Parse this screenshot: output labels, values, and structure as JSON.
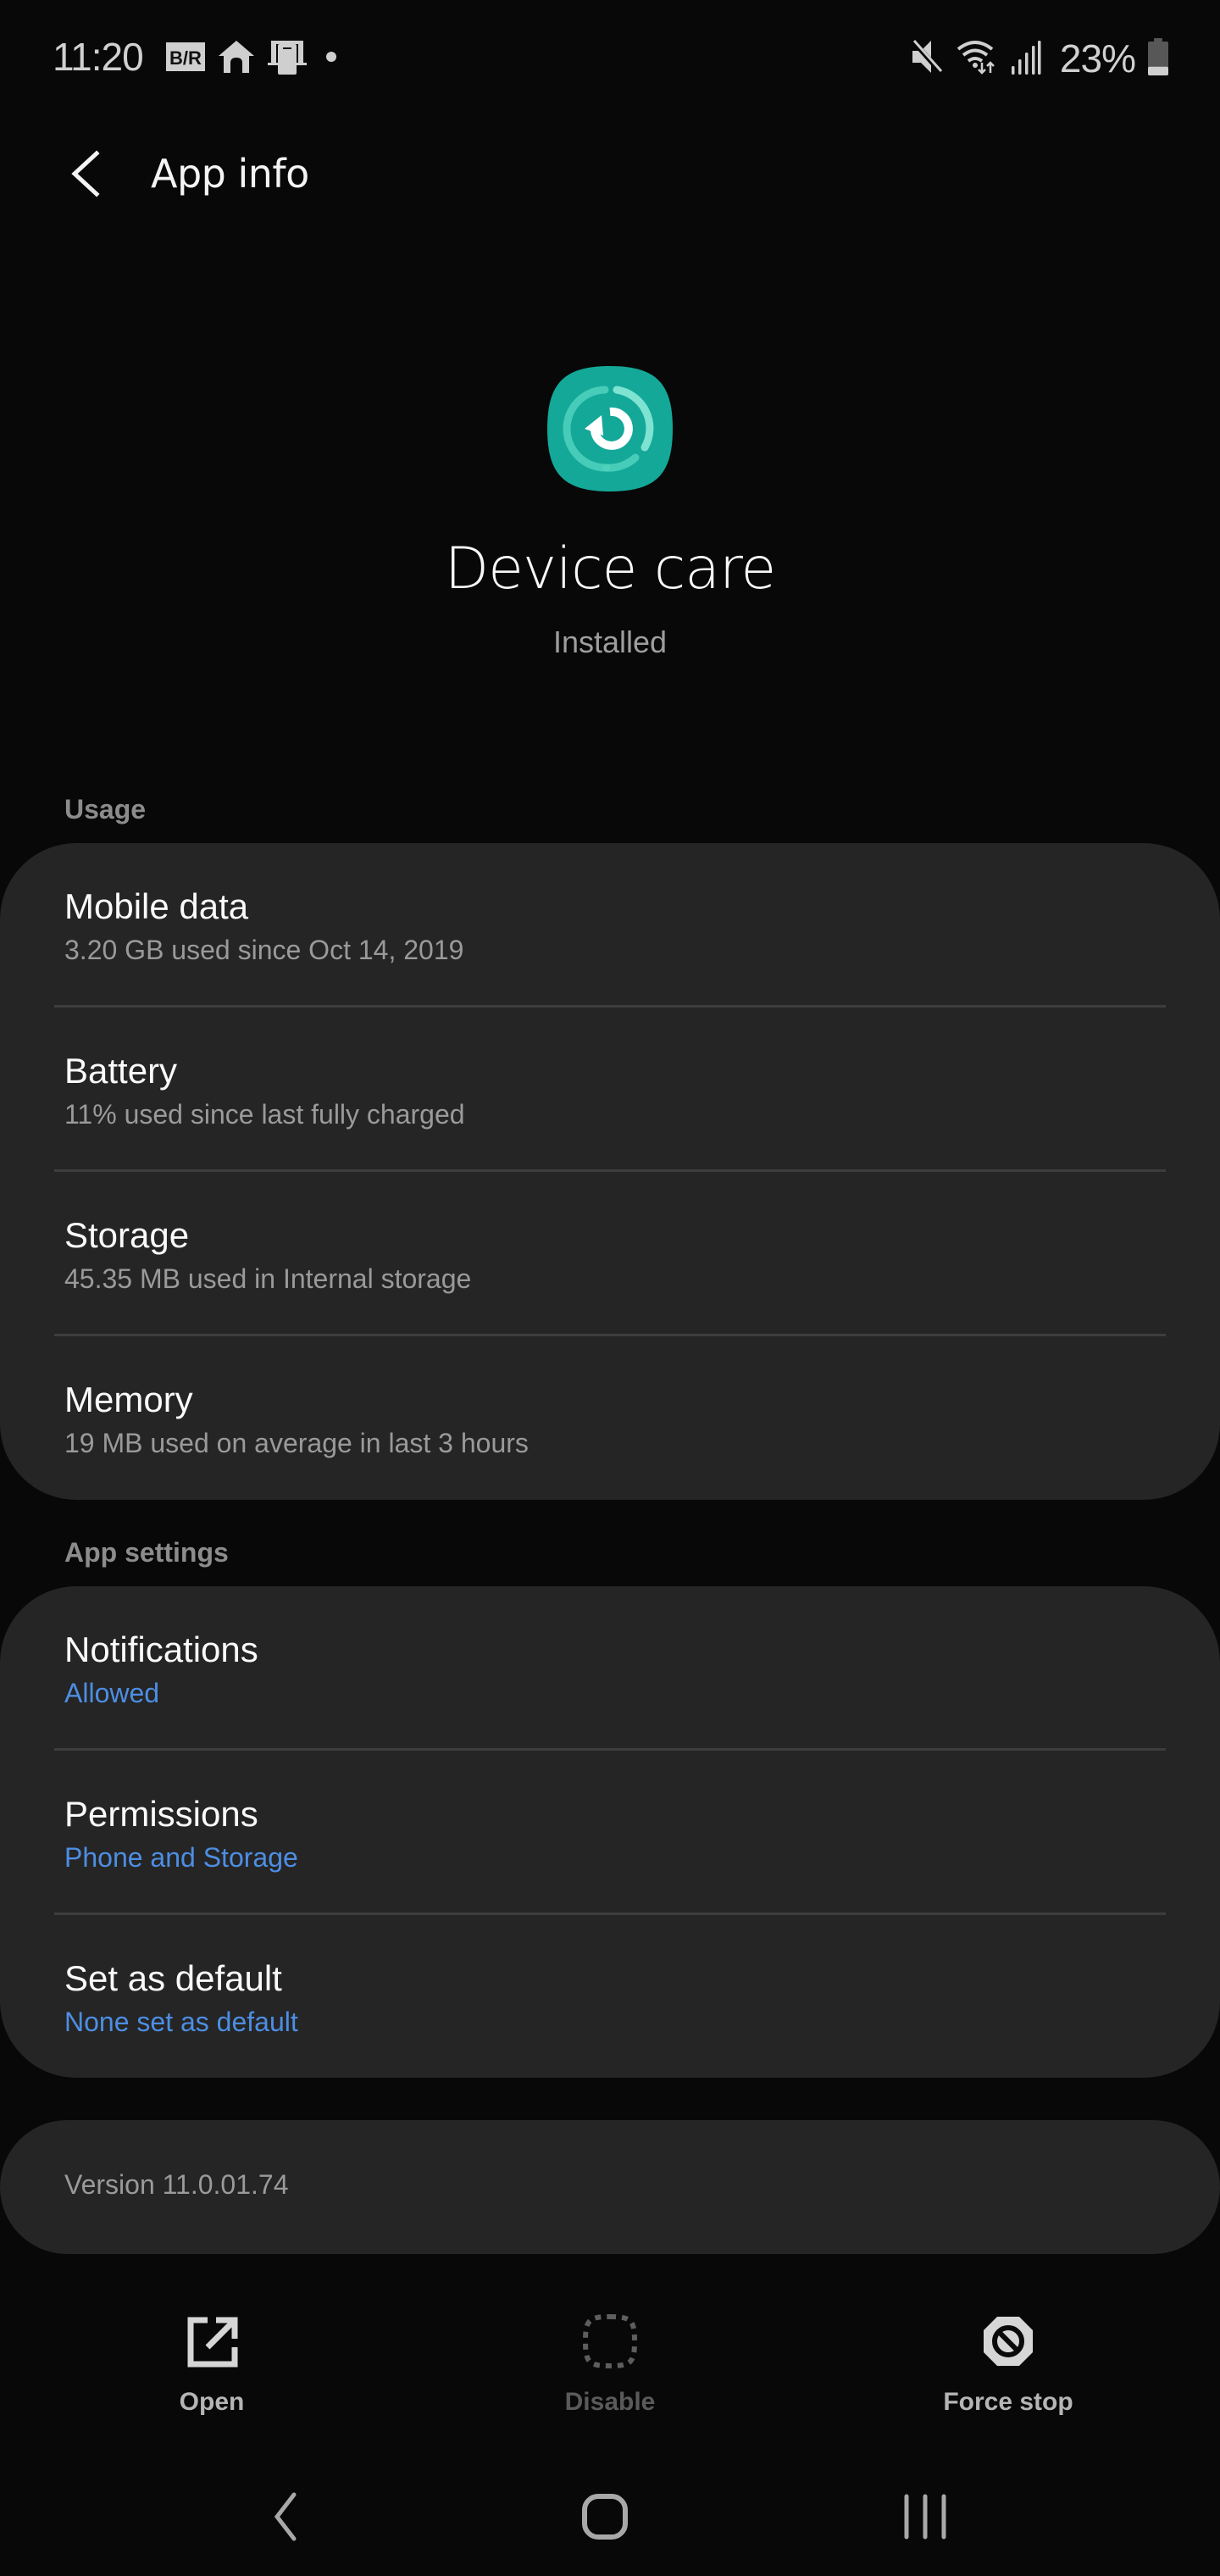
{
  "status_bar": {
    "time": "11:20",
    "left_icons": [
      "bleacher-report-icon",
      "home-icon",
      "device-icon",
      "dot-icon"
    ],
    "right_icons": [
      "mute-icon",
      "wifi-icon",
      "signal-icon",
      "battery-icon"
    ],
    "battery_percent_text": "23%",
    "battery_level": 0.23,
    "br_badge_text": "B/R"
  },
  "app_bar": {
    "title": "App info",
    "back_icon": "back-chevron-icon"
  },
  "app": {
    "name": "Device care",
    "status": "Installed",
    "icon": "device-care-icon",
    "icon_color": "#14a899"
  },
  "usage": {
    "label": "Usage",
    "items": [
      {
        "title": "Mobile data",
        "subtitle": "3.20 GB used since Oct 14, 2019"
      },
      {
        "title": "Battery",
        "subtitle": "11% used since last fully charged"
      },
      {
        "title": "Storage",
        "subtitle": "45.35 MB used in Internal storage"
      },
      {
        "title": "Memory",
        "subtitle": "19 MB used on average in last 3 hours"
      }
    ]
  },
  "app_settings": {
    "label": "App settings",
    "accent_color": "#4d8ee3",
    "items": [
      {
        "title": "Notifications",
        "subtitle": "Allowed"
      },
      {
        "title": "Permissions",
        "subtitle": "Phone and Storage"
      },
      {
        "title": "Set as default",
        "subtitle": "None set as default"
      }
    ]
  },
  "version": {
    "text": "Version 11.0.01.74"
  },
  "actions": [
    {
      "label": "Open",
      "icon": "open-external-icon",
      "enabled": true
    },
    {
      "label": "Disable",
      "icon": "disable-icon",
      "enabled": false
    },
    {
      "label": "Force stop",
      "icon": "force-stop-icon",
      "enabled": true
    }
  ],
  "nav_bar": {
    "buttons": [
      "back-icon",
      "home-icon",
      "recents-icon"
    ]
  }
}
